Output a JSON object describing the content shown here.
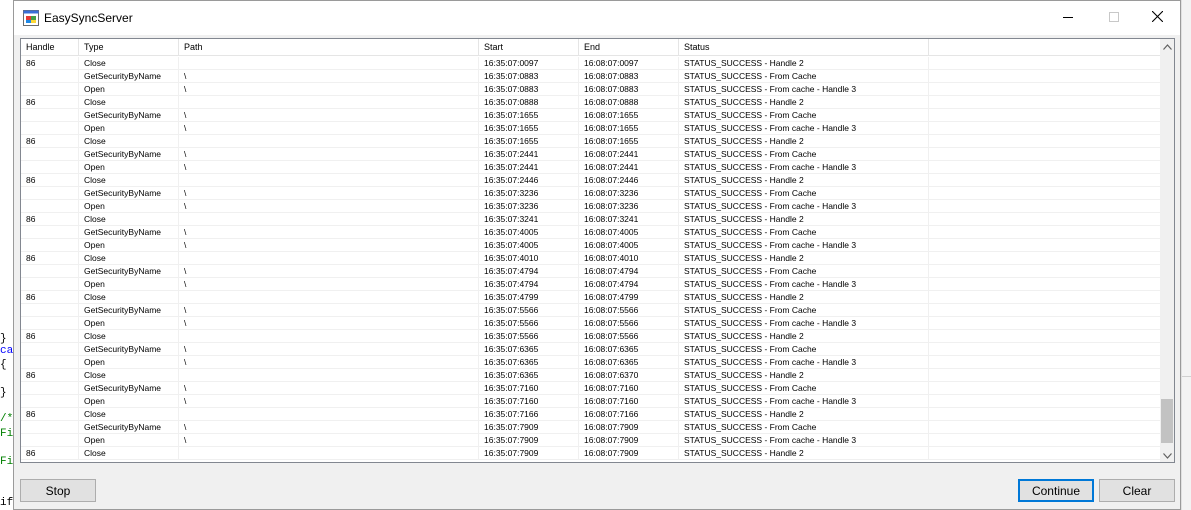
{
  "window": {
    "title": "EasySyncServer"
  },
  "background_editor": {
    "lines": [
      {
        "text": "}",
        "color": "#000000"
      },
      {
        "text": "ca",
        "color": "#0000ff"
      },
      {
        "text": "{",
        "color": "#000000"
      },
      {
        "text": "}",
        "color": "#000000"
      },
      {
        "text": "/*",
        "color": "#008000"
      },
      {
        "text": "Fi",
        "color": "#008000"
      },
      {
        "text": "Fi",
        "color": "#008000"
      },
      {
        "text": "if",
        "color": "#000000"
      }
    ]
  },
  "list": {
    "columns": [
      "Handle",
      "Type",
      "Path",
      "Start",
      "End",
      "Status",
      ""
    ],
    "rows": [
      {
        "handle": "86",
        "type": "Close",
        "path": "",
        "start": "16:35:07:0097",
        "end": "16:08:07:0097",
        "status": "STATUS_SUCCESS - Handle 2"
      },
      {
        "handle": "",
        "type": "GetSecurityByName",
        "path": "\\",
        "start": "16:35:07:0883",
        "end": "16:08:07:0883",
        "status": "STATUS_SUCCESS - From Cache"
      },
      {
        "handle": "",
        "type": "Open",
        "path": "\\",
        "start": "16:35:07:0883",
        "end": "16:08:07:0883",
        "status": "STATUS_SUCCESS - From cache - Handle 3"
      },
      {
        "handle": "86",
        "type": "Close",
        "path": "",
        "start": "16:35:07:0888",
        "end": "16:08:07:0888",
        "status": "STATUS_SUCCESS - Handle 2"
      },
      {
        "handle": "",
        "type": "GetSecurityByName",
        "path": "\\",
        "start": "16:35:07:1655",
        "end": "16:08:07:1655",
        "status": "STATUS_SUCCESS - From Cache"
      },
      {
        "handle": "",
        "type": "Open",
        "path": "\\",
        "start": "16:35:07:1655",
        "end": "16:08:07:1655",
        "status": "STATUS_SUCCESS - From cache - Handle 3"
      },
      {
        "handle": "86",
        "type": "Close",
        "path": "",
        "start": "16:35:07:1655",
        "end": "16:08:07:1655",
        "status": "STATUS_SUCCESS - Handle 2"
      },
      {
        "handle": "",
        "type": "GetSecurityByName",
        "path": "\\",
        "start": "16:35:07:2441",
        "end": "16:08:07:2441",
        "status": "STATUS_SUCCESS - From Cache"
      },
      {
        "handle": "",
        "type": "Open",
        "path": "\\",
        "start": "16:35:07:2441",
        "end": "16:08:07:2441",
        "status": "STATUS_SUCCESS - From cache - Handle 3"
      },
      {
        "handle": "86",
        "type": "Close",
        "path": "",
        "start": "16:35:07:2446",
        "end": "16:08:07:2446",
        "status": "STATUS_SUCCESS - Handle 2"
      },
      {
        "handle": "",
        "type": "GetSecurityByName",
        "path": "\\",
        "start": "16:35:07:3236",
        "end": "16:08:07:3236",
        "status": "STATUS_SUCCESS - From Cache"
      },
      {
        "handle": "",
        "type": "Open",
        "path": "\\",
        "start": "16:35:07:3236",
        "end": "16:08:07:3236",
        "status": "STATUS_SUCCESS - From cache - Handle 3"
      },
      {
        "handle": "86",
        "type": "Close",
        "path": "",
        "start": "16:35:07:3241",
        "end": "16:08:07:3241",
        "status": "STATUS_SUCCESS - Handle 2"
      },
      {
        "handle": "",
        "type": "GetSecurityByName",
        "path": "\\",
        "start": "16:35:07:4005",
        "end": "16:08:07:4005",
        "status": "STATUS_SUCCESS - From Cache"
      },
      {
        "handle": "",
        "type": "Open",
        "path": "\\",
        "start": "16:35:07:4005",
        "end": "16:08:07:4005",
        "status": "STATUS_SUCCESS - From cache - Handle 3"
      },
      {
        "handle": "86",
        "type": "Close",
        "path": "",
        "start": "16:35:07:4010",
        "end": "16:08:07:4010",
        "status": "STATUS_SUCCESS - Handle 2"
      },
      {
        "handle": "",
        "type": "GetSecurityByName",
        "path": "\\",
        "start": "16:35:07:4794",
        "end": "16:08:07:4794",
        "status": "STATUS_SUCCESS - From Cache"
      },
      {
        "handle": "",
        "type": "Open",
        "path": "\\",
        "start": "16:35:07:4794",
        "end": "16:08:07:4794",
        "status": "STATUS_SUCCESS - From cache - Handle 3"
      },
      {
        "handle": "86",
        "type": "Close",
        "path": "",
        "start": "16:35:07:4799",
        "end": "16:08:07:4799",
        "status": "STATUS_SUCCESS - Handle 2"
      },
      {
        "handle": "",
        "type": "GetSecurityByName",
        "path": "\\",
        "start": "16:35:07:5566",
        "end": "16:08:07:5566",
        "status": "STATUS_SUCCESS - From Cache"
      },
      {
        "handle": "",
        "type": "Open",
        "path": "\\",
        "start": "16:35:07:5566",
        "end": "16:08:07:5566",
        "status": "STATUS_SUCCESS - From cache - Handle 3"
      },
      {
        "handle": "86",
        "type": "Close",
        "path": "",
        "start": "16:35:07:5566",
        "end": "16:08:07:5566",
        "status": "STATUS_SUCCESS - Handle 2"
      },
      {
        "handle": "",
        "type": "GetSecurityByName",
        "path": "\\",
        "start": "16:35:07:6365",
        "end": "16:08:07:6365",
        "status": "STATUS_SUCCESS - From Cache"
      },
      {
        "handle": "",
        "type": "Open",
        "path": "\\",
        "start": "16:35:07:6365",
        "end": "16:08:07:6365",
        "status": "STATUS_SUCCESS - From cache - Handle 3"
      },
      {
        "handle": "86",
        "type": "Close",
        "path": "",
        "start": "16:35:07:6365",
        "end": "16:08:07:6370",
        "status": "STATUS_SUCCESS - Handle 2"
      },
      {
        "handle": "",
        "type": "GetSecurityByName",
        "path": "\\",
        "start": "16:35:07:7160",
        "end": "16:08:07:7160",
        "status": "STATUS_SUCCESS - From Cache"
      },
      {
        "handle": "",
        "type": "Open",
        "path": "\\",
        "start": "16:35:07:7160",
        "end": "16:08:07:7160",
        "status": "STATUS_SUCCESS - From cache - Handle 3"
      },
      {
        "handle": "86",
        "type": "Close",
        "path": "",
        "start": "16:35:07:7166",
        "end": "16:08:07:7166",
        "status": "STATUS_SUCCESS - Handle 2"
      },
      {
        "handle": "",
        "type": "GetSecurityByName",
        "path": "\\",
        "start": "16:35:07:7909",
        "end": "16:08:07:7909",
        "status": "STATUS_SUCCESS - From Cache"
      },
      {
        "handle": "",
        "type": "Open",
        "path": "\\",
        "start": "16:35:07:7909",
        "end": "16:08:07:7909",
        "status": "STATUS_SUCCESS - From cache - Handle 3"
      },
      {
        "handle": "86",
        "type": "Close",
        "path": "",
        "start": "16:35:07:7909",
        "end": "16:08:07:7909",
        "status": "STATUS_SUCCESS - Handle 2"
      }
    ]
  },
  "buttons": {
    "stop": "Stop",
    "continue": "Continue",
    "clear": "Clear"
  },
  "colors": {
    "window_bg": "#f0f0f0",
    "focus_border": "#0078d7",
    "scroll_thumb": "#c2c2c2"
  },
  "icons": {
    "app": "app-window-icon",
    "minimize": "minimize-icon",
    "maximize": "maximize-icon",
    "close": "close-icon",
    "scroll_up": "chevron-up-icon",
    "scroll_down": "chevron-down-icon"
  }
}
